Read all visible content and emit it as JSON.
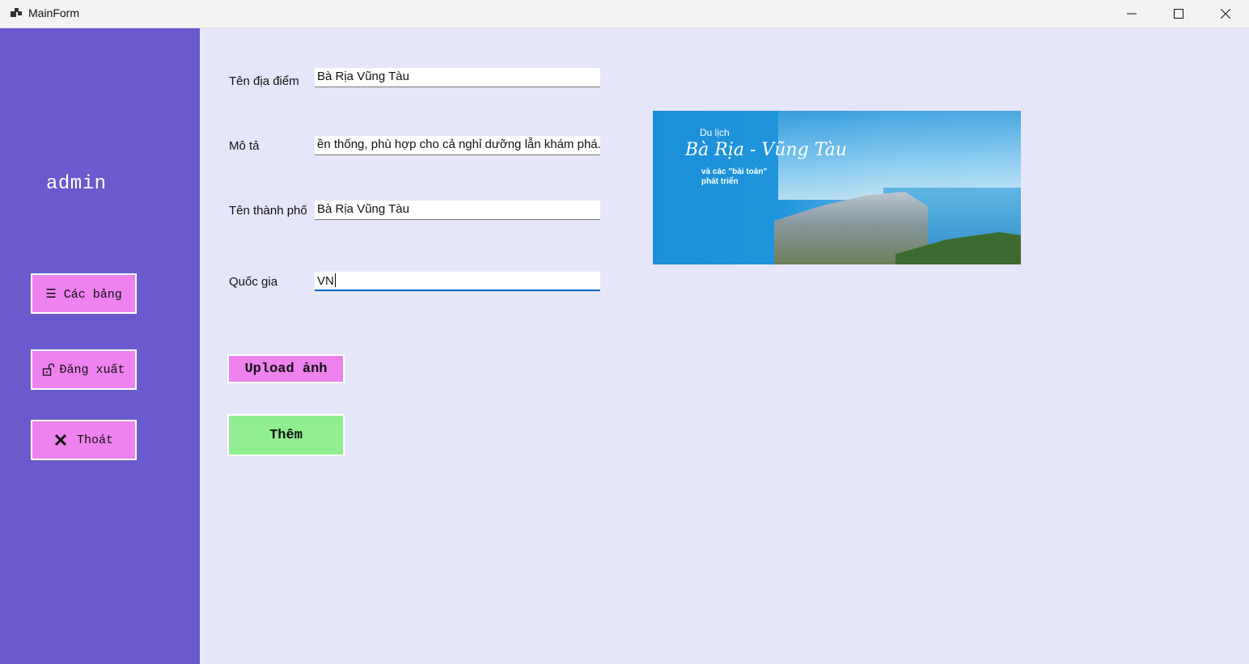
{
  "window": {
    "title": "MainForm"
  },
  "sidebar": {
    "username": "admin",
    "buttons": {
      "tables": "☰ Các bảng",
      "logout": "Đăng xuất",
      "exit": "Thoát"
    }
  },
  "form": {
    "place_name": {
      "label": "Tên địa điểm",
      "value": "Bà Rịa Vũng Tàu"
    },
    "description": {
      "label": "Mô tả",
      "value": "ền thống, phù hợp cho cả nghỉ dưỡng lẫn khám phá."
    },
    "city": {
      "label": "Tên thành phố",
      "value": "Bà Rịa Vũng Tàu"
    },
    "country": {
      "label": "Quốc gia",
      "value": "VN"
    },
    "upload_label": "Upload ảnh",
    "add_label": "Thêm"
  },
  "preview_image": {
    "small_text": "Du lịch",
    "script_text": "Bà Rịa - Vũng Tàu",
    "sub_text_1": "và các \"bài toán\"",
    "sub_text_2": "phát triển"
  },
  "icons": {
    "app": "app-window-icon",
    "minimize": "minimize-icon",
    "maximize": "maximize-icon",
    "close": "close-icon",
    "logout": "unlock-icon",
    "exit": "x-icon"
  },
  "colors": {
    "sidebar": "#6a5acd",
    "background": "#e6e6fa",
    "button_pink": "#ee82ee",
    "button_green": "#90ee90"
  }
}
